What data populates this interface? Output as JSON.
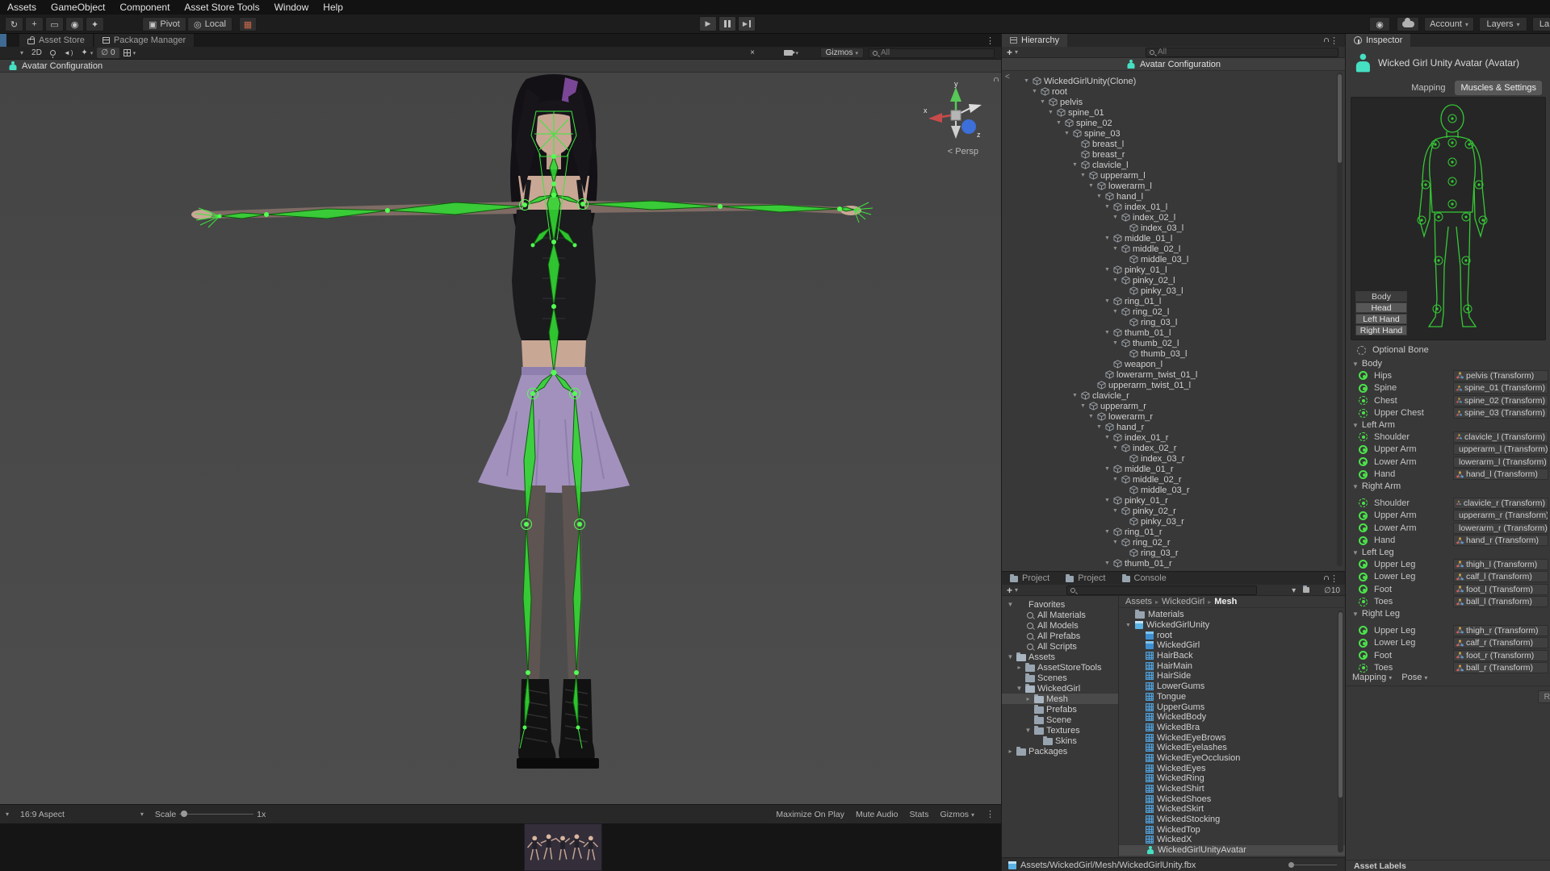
{
  "colors": {
    "accent_teal": "#45e0c2",
    "bone_green": "#33d633",
    "joint_green": "#52ff52",
    "icon_blue": "#4f9fd8",
    "selection_gray": "#4a4a4a",
    "star_yellow": "#e8b931",
    "axis_x_red": "#c84b4b",
    "axis_y_green": "#58c858",
    "axis_z_blue": "#3d6fd8"
  },
  "glyphs": {
    "foldout_open": "▼",
    "chev_down": "▾",
    "chev_right": "▸",
    "plus": "+",
    "kebab": "⋮",
    "eye_off": "∅",
    "play": "▶",
    "speaker": "◄",
    "wave": ")",
    "sparkle": "✦",
    "snap": "▦",
    "pivot_ic": "▣",
    "local_ic": "◎",
    "hub": "◉",
    "lt": "<",
    "tool_view": "↻",
    "tool_move": "+",
    "tool_rect": "▭",
    "tool_scale": "◉",
    "tool_custom": "✦",
    "tools_x": "×"
  },
  "menu": {
    "items": [
      "Assets",
      "GameObject",
      "Component",
      "Asset Store Tools",
      "Window",
      "Help"
    ]
  },
  "toolbar": {
    "pivot": "Pivot",
    "local": "Local",
    "account": "Account",
    "layers": "Layers",
    "layout_clipped": "La"
  },
  "scene": {
    "tabs": [
      "Asset Store",
      "Package Manager"
    ],
    "toolbar": {
      "mode_2d": "2D",
      "hidden_count": "0",
      "gizmos": "Gizmos",
      "search_placeholder": "All"
    },
    "overlay_title": "Avatar Configuration",
    "gizmo": {
      "x": "x",
      "y": "y",
      "z": "z",
      "persp": "< Persp"
    },
    "bottom": {
      "aspect": "16:9 Aspect",
      "scale_label": "Scale",
      "scale_value": "1x",
      "maximize": "Maximize On Play",
      "mute": "Mute Audio",
      "stats": "Stats",
      "gizmos": "Gizmos"
    }
  },
  "hierarchy": {
    "tab": "Hierarchy",
    "search_placeholder": "All",
    "header": "Avatar Configuration",
    "tree": [
      {
        "label": "WickedGirlUnity(Clone)",
        "level": 0,
        "arrow": "▼"
      },
      {
        "label": "root",
        "level": 1,
        "arrow": "▼"
      },
      {
        "label": "pelvis",
        "level": 2,
        "arrow": "▼"
      },
      {
        "label": "spine_01",
        "level": 3,
        "arrow": "▼"
      },
      {
        "label": "spine_02",
        "level": 4,
        "arrow": "▼"
      },
      {
        "label": "spine_03",
        "level": 5,
        "arrow": "▼"
      },
      {
        "label": "breast_l",
        "level": 6,
        "arrow": ""
      },
      {
        "label": "breast_r",
        "level": 6,
        "arrow": ""
      },
      {
        "label": "clavicle_l",
        "level": 6,
        "arrow": "▼"
      },
      {
        "label": "upperarm_l",
        "level": 7,
        "arrow": "▼"
      },
      {
        "label": "lowerarm_l",
        "level": 8,
        "arrow": "▼"
      },
      {
        "label": "hand_l",
        "level": 9,
        "arrow": "▼"
      },
      {
        "label": "index_01_l",
        "level": 10,
        "arrow": "▼"
      },
      {
        "label": "index_02_l",
        "level": 11,
        "arrow": "▼"
      },
      {
        "label": "index_03_l",
        "level": 12,
        "arrow": ""
      },
      {
        "label": "middle_01_l",
        "level": 10,
        "arrow": "▼"
      },
      {
        "label": "middle_02_l",
        "level": 11,
        "arrow": "▼"
      },
      {
        "label": "middle_03_l",
        "level": 12,
        "arrow": ""
      },
      {
        "label": "pinky_01_l",
        "level": 10,
        "arrow": "▼"
      },
      {
        "label": "pinky_02_l",
        "level": 11,
        "arrow": "▼"
      },
      {
        "label": "pinky_03_l",
        "level": 12,
        "arrow": ""
      },
      {
        "label": "ring_01_l",
        "level": 10,
        "arrow": "▼"
      },
      {
        "label": "ring_02_l",
        "level": 11,
        "arrow": "▼"
      },
      {
        "label": "ring_03_l",
        "level": 12,
        "arrow": ""
      },
      {
        "label": "thumb_01_l",
        "level": 10,
        "arrow": "▼"
      },
      {
        "label": "thumb_02_l",
        "level": 11,
        "arrow": "▼"
      },
      {
        "label": "thumb_03_l",
        "level": 12,
        "arrow": ""
      },
      {
        "label": "weapon_l",
        "level": 10,
        "arrow": ""
      },
      {
        "label": "lowerarm_twist_01_l",
        "level": 9,
        "arrow": ""
      },
      {
        "label": "upperarm_twist_01_l",
        "level": 8,
        "arrow": ""
      },
      {
        "label": "clavicle_r",
        "level": 6,
        "arrow": "▼"
      },
      {
        "label": "upperarm_r",
        "level": 7,
        "arrow": "▼"
      },
      {
        "label": "lowerarm_r",
        "level": 8,
        "arrow": "▼"
      },
      {
        "label": "hand_r",
        "level": 9,
        "arrow": "▼"
      },
      {
        "label": "index_01_r",
        "level": 10,
        "arrow": "▼"
      },
      {
        "label": "index_02_r",
        "level": 11,
        "arrow": "▼"
      },
      {
        "label": "index_03_r",
        "level": 12,
        "arrow": ""
      },
      {
        "label": "middle_01_r",
        "level": 10,
        "arrow": "▼"
      },
      {
        "label": "middle_02_r",
        "level": 11,
        "arrow": "▼"
      },
      {
        "label": "middle_03_r",
        "level": 12,
        "arrow": ""
      },
      {
        "label": "pinky_01_r",
        "level": 10,
        "arrow": "▼"
      },
      {
        "label": "pinky_02_r",
        "level": 11,
        "arrow": "▼"
      },
      {
        "label": "pinky_03_r",
        "level": 12,
        "arrow": ""
      },
      {
        "label": "ring_01_r",
        "level": 10,
        "arrow": "▼"
      },
      {
        "label": "ring_02_r",
        "level": 11,
        "arrow": "▼"
      },
      {
        "label": "ring_03_r",
        "level": 12,
        "arrow": ""
      },
      {
        "label": "thumb_01_r",
        "level": 10,
        "arrow": "▼"
      }
    ]
  },
  "project": {
    "tabs": [
      {
        "label": "Project",
        "active": false
      },
      {
        "label": "Project",
        "active": true
      },
      {
        "label": "Console",
        "active": false
      }
    ],
    "search_placeholder": "",
    "hidden_count": "10",
    "left_tree": [
      {
        "label": "Favorites",
        "level": 0,
        "icon": "star",
        "arrow": "▼",
        "cls": ""
      },
      {
        "label": "All Materials",
        "level": 1,
        "icon": "searchi",
        "arrow": "",
        "cls": ""
      },
      {
        "label": "All Models",
        "level": 1,
        "icon": "searchi",
        "arrow": "",
        "cls": ""
      },
      {
        "label": "All Prefabs",
        "level": 1,
        "icon": "searchi",
        "arrow": "",
        "cls": ""
      },
      {
        "label": "All Scripts",
        "level": 1,
        "icon": "searchi",
        "arrow": "",
        "cls": ""
      },
      {
        "label": "Assets",
        "level": 0,
        "icon": "folder-open",
        "arrow": "▼",
        "cls": "gap-top"
      },
      {
        "label": "AssetStoreTools",
        "level": 1,
        "icon": "folder",
        "arrow": "▸",
        "cls": ""
      },
      {
        "label": "Scenes",
        "level": 1,
        "icon": "folder",
        "arrow": "",
        "cls": ""
      },
      {
        "label": "WickedGirl",
        "level": 1,
        "icon": "folder-open",
        "arrow": "▼",
        "cls": ""
      },
      {
        "label": "Mesh",
        "level": 2,
        "icon": "folder-open",
        "arrow": "▸",
        "cls": "selected"
      },
      {
        "label": "Prefabs",
        "level": 2,
        "icon": "folder",
        "arrow": "",
        "cls": ""
      },
      {
        "label": "Scene",
        "level": 2,
        "icon": "folder",
        "arrow": "",
        "cls": ""
      },
      {
        "label": "Textures",
        "level": 2,
        "icon": "folder",
        "arrow": "▼",
        "cls": ""
      },
      {
        "label": "Skins",
        "level": 3,
        "icon": "folder",
        "arrow": "",
        "cls": ""
      },
      {
        "label": "Packages",
        "level": 0,
        "icon": "folder",
        "arrow": "▸",
        "cls": "gap-top"
      }
    ],
    "breadcrumb": {
      "parts": [
        "Assets",
        "WickedGirl"
      ],
      "last": "Mesh",
      "sep": "▸"
    },
    "files": [
      {
        "name": "Materials",
        "level": 0,
        "icon": "folder",
        "arrow": "",
        "cls": ""
      },
      {
        "name": "WickedGirlUnity",
        "level": 0,
        "icon": "model",
        "arrow": "▼",
        "cls": ""
      },
      {
        "name": "root",
        "level": 1,
        "icon": "cube",
        "arrow": "",
        "cls": ""
      },
      {
        "name": "WickedGirl",
        "level": 1,
        "icon": "cube",
        "arrow": "",
        "cls": ""
      },
      {
        "name": "HairBack",
        "level": 1,
        "icon": "mesh",
        "arrow": "",
        "cls": ""
      },
      {
        "name": "HairMain",
        "level": 1,
        "icon": "mesh",
        "arrow": "",
        "cls": ""
      },
      {
        "name": "HairSide",
        "level": 1,
        "icon": "mesh",
        "arrow": "",
        "cls": ""
      },
      {
        "name": "LowerGums",
        "level": 1,
        "icon": "mesh",
        "arrow": "",
        "cls": ""
      },
      {
        "name": "Tongue",
        "level": 1,
        "icon": "mesh",
        "arrow": "",
        "cls": ""
      },
      {
        "name": "UpperGums",
        "level": 1,
        "icon": "mesh",
        "arrow": "",
        "cls": ""
      },
      {
        "name": "WickedBody",
        "level": 1,
        "icon": "mesh",
        "arrow": "",
        "cls": ""
      },
      {
        "name": "WickedBra",
        "level": 1,
        "icon": "mesh",
        "arrow": "",
        "cls": ""
      },
      {
        "name": "WickedEyeBrows",
        "level": 1,
        "icon": "mesh",
        "arrow": "",
        "cls": ""
      },
      {
        "name": "WickedEyelashes",
        "level": 1,
        "icon": "mesh",
        "arrow": "",
        "cls": ""
      },
      {
        "name": "WickedEyeOcclusion",
        "level": 1,
        "icon": "mesh",
        "arrow": "",
        "cls": ""
      },
      {
        "name": "WickedEyes",
        "level": 1,
        "icon": "mesh",
        "arrow": "",
        "cls": ""
      },
      {
        "name": "WickedRing",
        "level": 1,
        "icon": "mesh",
        "arrow": "",
        "cls": ""
      },
      {
        "name": "WickedShirt",
        "level": 1,
        "icon": "mesh",
        "arrow": "",
        "cls": ""
      },
      {
        "name": "WickedShoes",
        "level": 1,
        "icon": "mesh",
        "arrow": "",
        "cls": ""
      },
      {
        "name": "WickedSkirt",
        "level": 1,
        "icon": "mesh",
        "arrow": "",
        "cls": ""
      },
      {
        "name": "WickedStocking",
        "level": 1,
        "icon": "mesh",
        "arrow": "",
        "cls": ""
      },
      {
        "name": "WickedTop",
        "level": 1,
        "icon": "mesh",
        "arrow": "",
        "cls": ""
      },
      {
        "name": "WickedX",
        "level": 1,
        "icon": "mesh",
        "arrow": "",
        "cls": ""
      },
      {
        "name": "WickedGirlUnityAvatar",
        "level": 1,
        "icon": "avatar",
        "arrow": "",
        "cls": "selected"
      }
    ],
    "path": "Assets/WickedGirl/Mesh/WickedGirlUnity.fbx"
  },
  "inspector": {
    "tab": "Inspector",
    "title": "Wicked Girl Unity Avatar (Avatar)",
    "tabs": [
      {
        "label": "Mapping",
        "cls": ""
      },
      {
        "label": "Muscles & Settings",
        "cls": "active"
      }
    ],
    "body_buttons": [
      {
        "label": "Body",
        "cls": "active"
      },
      {
        "label": "Head",
        "cls": ""
      },
      {
        "label": "Left Hand",
        "cls": ""
      },
      {
        "label": "Right Hand",
        "cls": ""
      }
    ],
    "optional_bone": "Optional Bone",
    "sections": [
      {
        "name": "Body",
        "cls": "",
        "rows": [
          {
            "label": "Hips",
            "value": "pelvis (Transform)",
            "cls": "req"
          },
          {
            "label": "Spine",
            "value": "spine_01 (Transform)",
            "cls": "req"
          },
          {
            "label": "Chest",
            "value": "spine_02 (Transform)",
            "cls": "opt"
          },
          {
            "label": "Upper Chest",
            "value": "spine_03 (Transform)",
            "cls": "opt"
          }
        ]
      },
      {
        "name": "Left Arm",
        "cls": "",
        "rows": [
          {
            "label": "Shoulder",
            "value": "clavicle_l (Transform)",
            "cls": "opt"
          },
          {
            "label": "Upper Arm",
            "value": "upperarm_l (Transform)",
            "cls": "req"
          },
          {
            "label": "Lower Arm",
            "value": "lowerarm_l (Transform)",
            "cls": "req"
          },
          {
            "label": "Hand",
            "value": "hand_l (Transform)",
            "cls": "req"
          }
        ]
      },
      {
        "name": "Right Arm",
        "cls": "gap",
        "rows": [
          {
            "label": "Shoulder",
            "value": "clavicle_r (Transform)",
            "cls": "opt"
          },
          {
            "label": "Upper Arm",
            "value": "upperarm_r (Transform)",
            "cls": "req"
          },
          {
            "label": "Lower Arm",
            "value": "lowerarm_r (Transform)",
            "cls": "req"
          },
          {
            "label": "Hand",
            "value": "hand_r (Transform)",
            "cls": "req"
          }
        ]
      },
      {
        "name": "Left Leg",
        "cls": "",
        "rows": [
          {
            "label": "Upper Leg",
            "value": "thigh_l (Transform)",
            "cls": "req"
          },
          {
            "label": "Lower Leg",
            "value": "calf_l (Transform)",
            "cls": "req"
          },
          {
            "label": "Foot",
            "value": "foot_l (Transform)",
            "cls": "req"
          },
          {
            "label": "Toes",
            "value": "ball_l (Transform)",
            "cls": "opt"
          }
        ]
      },
      {
        "name": "Right Leg",
        "cls": "gap",
        "rows": [
          {
            "label": "Upper Leg",
            "value": "thigh_r (Transform)",
            "cls": "req"
          },
          {
            "label": "Lower Leg",
            "value": "calf_r (Transform)",
            "cls": "req"
          },
          {
            "label": "Foot",
            "value": "foot_r (Transform)",
            "cls": "req"
          },
          {
            "label": "Toes",
            "value": "ball_r (Transform)",
            "cls": "opt"
          }
        ]
      }
    ],
    "footer": {
      "mapping": "Mapping",
      "pose": "Pose",
      "revert": "Revert"
    },
    "asset_labels": "Asset Labels"
  }
}
